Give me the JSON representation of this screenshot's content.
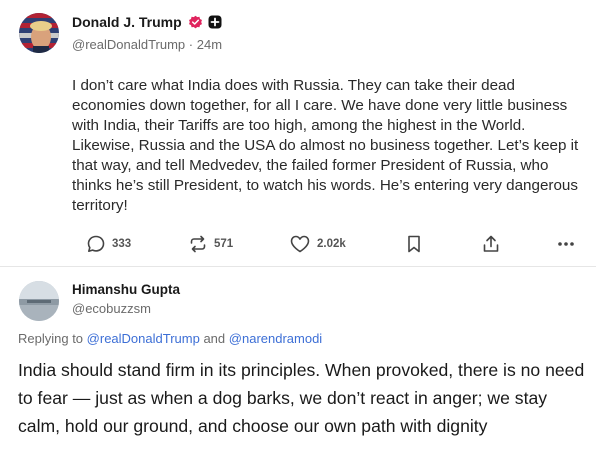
{
  "post": {
    "author_name": "Donald J. Trump",
    "handle": "@realDonaldTrump",
    "time": "24m",
    "text": "I don’t care what India does with Russia. They can take their dead economies down together, for all I care. We have done very little business with India, their Tariffs are too high, among the highest in the World. Likewise, Russia and the USA do almost no business together. Let’s keep it that way, and tell Medvedev, the failed former President of Russia, who thinks he’s still President, to watch his words. He’s entering very dangerous territory!",
    "actions": {
      "replies": "333",
      "reposts": "571",
      "likes": "2.02k"
    },
    "colors": {
      "verified": "#e0245e"
    }
  },
  "reply": {
    "author_name": "Himanshu Gupta",
    "handle": "@ecobuzzsm",
    "replying_prefix": "Replying to",
    "mention_1": "@realDonaldTrump",
    "conj": "and",
    "mention_2": "@narendramodi",
    "text": "India should stand firm in its principles. When provoked, there is no need to fear — just as when a dog barks, we don’t react in anger; we stay calm, hold our ground, and choose our own path with dignity",
    "colors": {
      "mention": "#3d6fd6"
    }
  },
  "icons": [
    "reply-icon",
    "repost-icon",
    "like-icon",
    "bookmark-icon",
    "share-icon",
    "more-icon",
    "verified-icon",
    "plus-icon"
  ]
}
